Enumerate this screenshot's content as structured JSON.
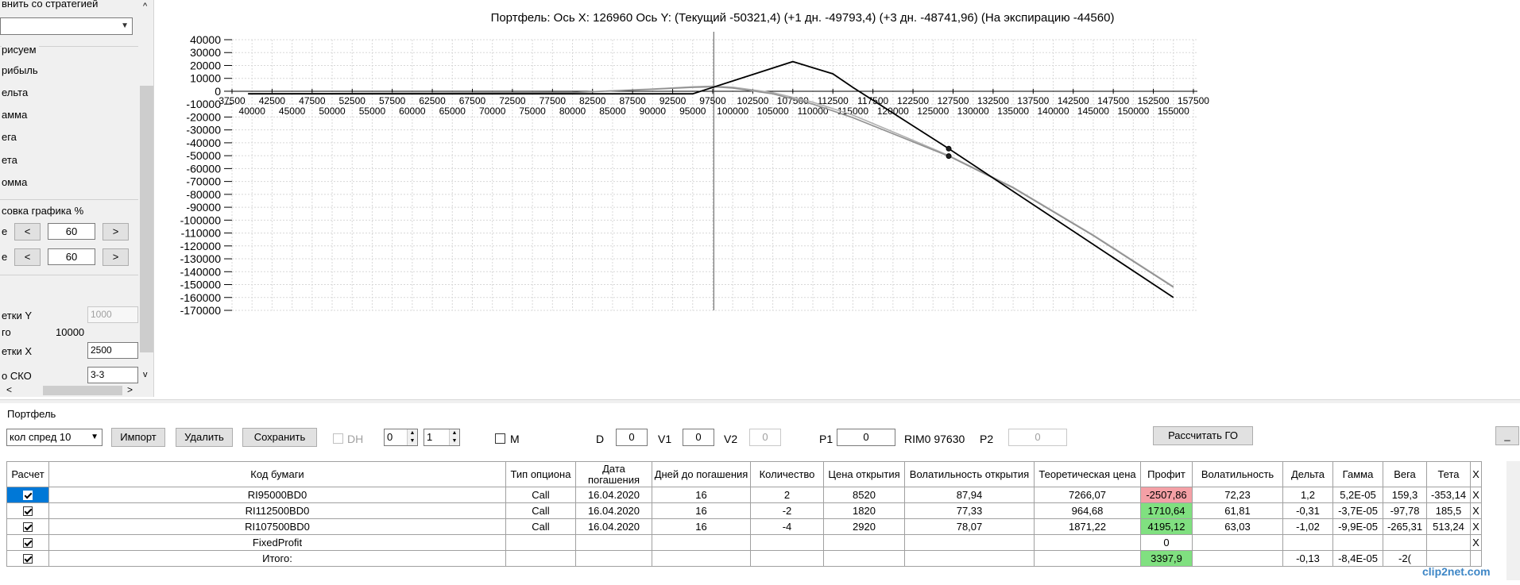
{
  "left_panel": {
    "compare_label": "внить со стратегией",
    "compare_combo": "",
    "draw_heading": "рисуем",
    "plot_options": [
      "рибыль",
      "ельта",
      "амма",
      "ега",
      "ета",
      "омма"
    ],
    "scale_heading": "совка графика %",
    "scale_row1_label": "е",
    "scale_row1_value": "60",
    "scale_row2_label": "е",
    "scale_row2_value": "60",
    "btn_less": "<",
    "btn_more": ">",
    "grid_y_label": "етки Y",
    "grid_y_value": "1000",
    "step_label": "го",
    "step_value": "10000",
    "grid_x_label": "етки X",
    "grid_x_value": "2500",
    "sko_label": "о СКО",
    "sko_value": "3-3",
    "scroll_up": "^",
    "scroll_down": "v",
    "scroll_left": "<",
    "scroll_right": ">"
  },
  "chart_title": "Портфель: Ось X: 126960 Ось Y:  (Текущий -50321,4)  (+1 дн. -49793,4)  (+3 дн. -48741,96)  (На экспирацию -44560)",
  "chart_data": {
    "type": "line",
    "x_ticks_upper": [
      "37500",
      "42500",
      "47500",
      "52500",
      "57500",
      "62500",
      "67500",
      "72500",
      "77500",
      "82500",
      "87500",
      "92500",
      "97500",
      "102500",
      "107500",
      "112500",
      "117500",
      "122500",
      "127500",
      "132500",
      "137500",
      "142500",
      "147500",
      "152500",
      "157500"
    ],
    "x_ticks_lower": [
      "40000",
      "45000",
      "50000",
      "55000",
      "60000",
      "65000",
      "70000",
      "75000",
      "80000",
      "85000",
      "90000",
      "95000",
      "100000",
      "105000",
      "110000",
      "115000",
      "120000",
      "125000",
      "130000",
      "135000",
      "140000",
      "145000",
      "150000",
      "155000"
    ],
    "y_ticks": [
      "40000",
      "30000",
      "20000",
      "10000",
      "0",
      "-10000",
      "-20000",
      "-30000",
      "-40000",
      "-50000",
      "-60000",
      "-70000",
      "-80000",
      "-90000",
      "-100000",
      "-110000",
      "-120000",
      "-130000",
      "-140000",
      "-150000",
      "-160000",
      "-170000"
    ],
    "xlim": [
      37500,
      158000
    ],
    "ylim": [
      -170000,
      40000
    ],
    "cursor_x": 97630,
    "series": [
      {
        "color": "#000000",
        "x": [
          39500,
          95000,
          107500,
          112500,
          115000,
          126960,
          155000
        ],
        "y": [
          -2000,
          -2000,
          23000,
          13500,
          3000,
          -44560,
          -160000
        ]
      },
      {
        "color": "#909090",
        "x": [
          39500,
          80000,
          90000,
          95000,
          97500,
          100000,
          105000,
          110000,
          115000,
          120000,
          126960,
          135000,
          145000,
          155000
        ],
        "y": [
          -2000,
          -1000,
          1500,
          3000,
          3500,
          2500,
          -2000,
          -10000,
          -20500,
          -33000,
          -50321,
          -75000,
          -112000,
          -152000
        ]
      },
      {
        "color": "#b0b0b0",
        "x": [
          39500,
          80000,
          90000,
          95000,
          97500,
          100000,
          105000,
          110000,
          115000,
          120000,
          126960,
          135000,
          145000,
          155000
        ],
        "y": [
          -2000,
          -1000,
          1800,
          3500,
          4000,
          3200,
          -1000,
          -8500,
          -18500,
          -31500,
          -49793,
          -74500,
          -111500,
          -151500
        ]
      }
    ],
    "markers": [
      {
        "x": 126960,
        "y": -44560
      },
      {
        "x": 126960,
        "y": -50321
      }
    ]
  },
  "portfolio": {
    "label": "Портфель",
    "strategy_combo": "кол спред 10",
    "btn_import": "Импорт",
    "btn_delete": "Удалить",
    "btn_save": "Сохранить",
    "dh_label": "DH",
    "spin1": "0",
    "spin2": "1",
    "m_label": "M",
    "d_label": "D",
    "d_value": "0",
    "v1_label": "V1",
    "v1_value": "0",
    "v2_label": "V2",
    "v2_value": "0",
    "p1_label": "P1",
    "p1_value": "0",
    "rim_label": "RIM0 97630",
    "p2_label": "P2",
    "p2_value": "0",
    "btn_calc": "Рассчитать ГО",
    "btn_underscore": "_"
  },
  "table": {
    "headers": [
      "Расчет",
      "Код бумаги",
      "Тип опциона",
      "Дата погашения",
      "Дней до погашения",
      "Количество",
      "Цена открытия",
      "Волатильность открытия",
      "Теоретическая цена",
      "Профит",
      "Волатильность",
      "Дельта",
      "Гамма",
      "Вега",
      "Тета",
      "X"
    ],
    "rows": [
      {
        "code": "RI95000BD0",
        "type": "Call",
        "date": "16.04.2020",
        "days": "16",
        "qty": "2",
        "open": "8520",
        "vol_open": "87,94",
        "theo": "7266,07",
        "profit": "-2507,86",
        "vol": "72,23",
        "delta": "1,2",
        "gamma": "5,2E-05",
        "vega": "159,3",
        "theta": "-353,14",
        "x": "X"
      },
      {
        "code": "RI112500BD0",
        "type": "Call",
        "date": "16.04.2020",
        "days": "16",
        "qty": "-2",
        "open": "1820",
        "vol_open": "77,33",
        "theo": "964,68",
        "profit": "1710,64",
        "vol": "61,81",
        "delta": "-0,31",
        "gamma": "-3,7E-05",
        "vega": "-97,78",
        "theta": "185,5",
        "x": "X"
      },
      {
        "code": "RI107500BD0",
        "type": "Call",
        "date": "16.04.2020",
        "days": "16",
        "qty": "-4",
        "open": "2920",
        "vol_open": "78,07",
        "theo": "1871,22",
        "profit": "4195,12",
        "vol": "63,03",
        "delta": "-1,02",
        "gamma": "-9,9E-05",
        "vega": "-265,31",
        "theta": "513,24",
        "x": "X"
      },
      {
        "code": "FixedProfit",
        "type": "",
        "date": "",
        "days": "",
        "qty": "",
        "open": "",
        "vol_open": "",
        "theo": "",
        "profit": "0",
        "vol": "",
        "delta": "",
        "gamma": "",
        "vega": "",
        "theta": "",
        "x": "X"
      },
      {
        "code": "Итого:",
        "type": "",
        "date": "",
        "days": "",
        "qty": "",
        "open": "",
        "vol_open": "",
        "theo": "",
        "profit": "3397,9",
        "vol": "",
        "delta": "-0,13",
        "gamma": "-8,4E-05",
        "vega": "-2(",
        "theta": "",
        "x": ""
      }
    ]
  },
  "watermark": "clip2net.com"
}
